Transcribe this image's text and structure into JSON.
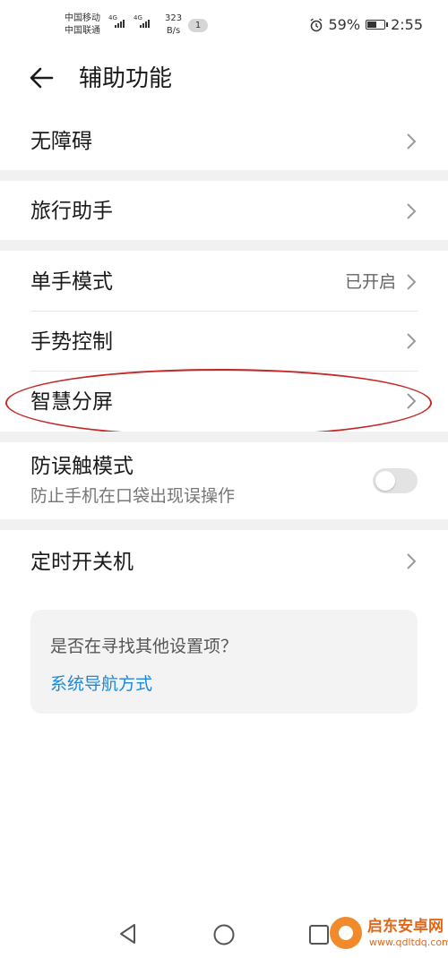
{
  "status_bar": {
    "carrier_1": "中国移动",
    "carrier_2": "中国联通",
    "net_1": "4G",
    "net_2": "4G",
    "speed_value": "323",
    "speed_unit": "B/s",
    "notification_count": "1",
    "battery_percent": "59%",
    "battery_level": 0.59,
    "time": "2:55",
    "alarm_icon": "alarm-clock-icon"
  },
  "header": {
    "title": "辅助功能",
    "back_icon": "arrow-left-icon"
  },
  "items": {
    "accessibility": "无障碍",
    "travel_assistant": "旅行助手",
    "one_hand_mode": "单手模式",
    "one_hand_mode_value": "已开启",
    "gesture_control": "手势控制",
    "smart_split_screen": "智慧分屏",
    "accidental_touch": "防误触模式",
    "accidental_touch_desc": "防止手机在口袋出现误操作",
    "accidental_touch_enabled": false,
    "scheduled_power": "定时开关机"
  },
  "card": {
    "question": "是否在寻找其他设置项？",
    "link": "系统导航方式"
  },
  "watermark": {
    "title": "启东安卓网",
    "url": "www.qdltdq.com"
  },
  "colors": {
    "accent_link": "#1e88d8",
    "highlight_ellipse": "#c62828",
    "section_gap": "#f1f1f1",
    "watermark": "#e0671a"
  }
}
